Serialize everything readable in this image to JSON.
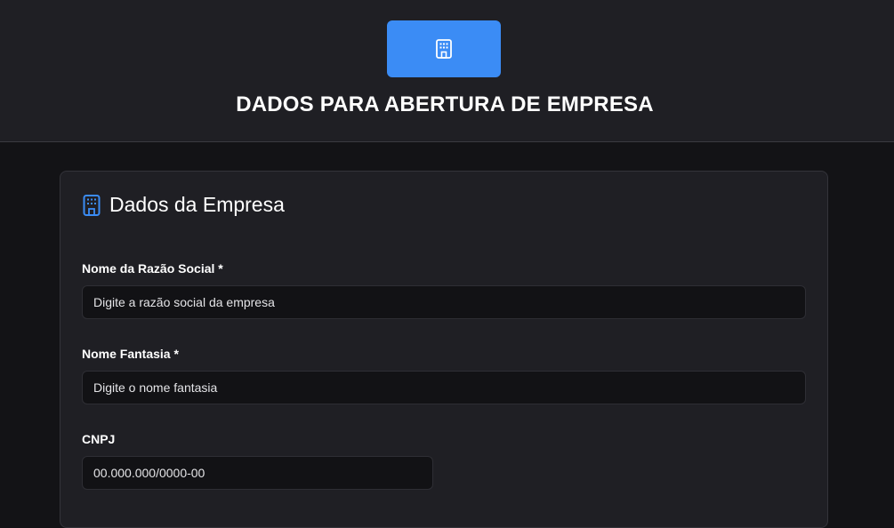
{
  "header": {
    "logo_icon": "building-icon",
    "title": "DADOS PARA ABERTURA DE EMPRESA",
    "accent_color": "#3b8cf5"
  },
  "section": {
    "icon": "building-icon",
    "title": "Dados da Empresa"
  },
  "fields": {
    "razao_social": {
      "label": "Nome da Razão Social *",
      "placeholder": "Digite a razão social da empresa"
    },
    "nome_fantasia": {
      "label": "Nome Fantasia *",
      "placeholder": "Digite o nome fantasia"
    },
    "cnpj": {
      "label": "CNPJ",
      "placeholder": "00.000.000/0000-00"
    }
  }
}
